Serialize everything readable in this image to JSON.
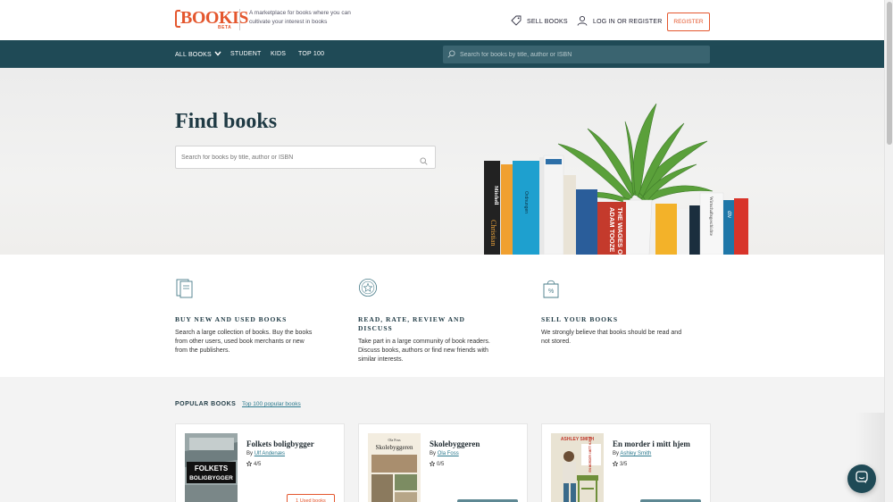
{
  "header": {
    "logo_text": "BOOKIS",
    "logo_badge": "BETA",
    "tagline": "A marketplace for books where you can cultivate your interest in books",
    "sell_label": "SELL BOOKS",
    "login_label": "LOG IN OR REGISTER",
    "register_label": "REGISTER",
    "accent_color": "#e4572e"
  },
  "nav": {
    "background": "#1f4a56",
    "items": [
      {
        "label": "ALL BOOKS",
        "has_dropdown": true
      },
      {
        "label": "STUDENT"
      },
      {
        "label": "KIDS"
      },
      {
        "label": "TOP 100"
      }
    ],
    "search_placeholder": "Search for books by title, author or ISBN"
  },
  "hero": {
    "title": "Find books",
    "search_placeholder": "Search for books by title, author or ISBN",
    "spines": [
      "Mitchell",
      "Ordnungen",
      "Christian",
      "ADAM TOOZE",
      "THE WAGES OF",
      "Wirtschaftsgeschichte",
      "dtv"
    ]
  },
  "features": [
    {
      "icon": "books-icon",
      "title": "BUY NEW AND USED BOOKS",
      "text": "Search a large collection of books. Buy the books from other users, used book merchants or new from the publishers."
    },
    {
      "icon": "star-badge-icon",
      "title": "READ, RATE, REVIEW AND DISCUSS",
      "text": "Take part in a large community of book readers. Discuss books, authors or find new friends with similar interests."
    },
    {
      "icon": "price-tag-icon",
      "title": "SELL YOUR BOOKS",
      "text": "We strongly believe that books should be read and not stored."
    }
  ],
  "popular": {
    "heading": "POPULAR BOOKS",
    "link_label": "Top 100 popular books",
    "books": [
      {
        "title": "Folkets boligbygger",
        "by": "By",
        "author": "Ulf Andenæs",
        "rating": "4/5",
        "cover_text": [
          "FOLKETS",
          "BOLIGBYGGER"
        ],
        "button_label": "1 Used books"
      },
      {
        "title": "Skolebyggeren",
        "by": "By",
        "author": "Ola Foss",
        "rating": "0/5",
        "cover_text": [
          "Ola Foss",
          "Skolebyggeren"
        ]
      },
      {
        "title": "En morder i mitt hjem",
        "by": "By",
        "author": "Ashley Smith",
        "rating": "3/5",
        "cover_text": [
          "ASHLEY SMITH",
          "EN MORDER I MITT HJEM"
        ]
      }
    ]
  }
}
